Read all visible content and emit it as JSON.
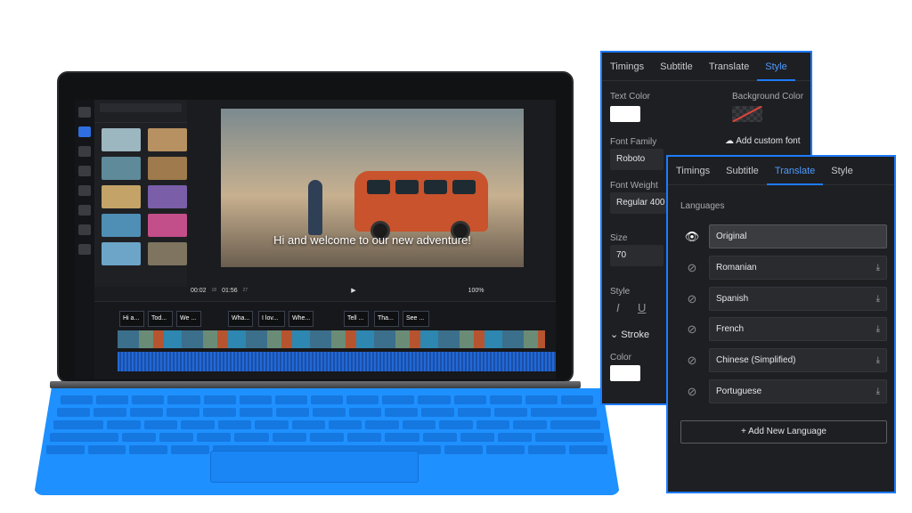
{
  "editor": {
    "current_time": "00:02",
    "current_time_frames": "18",
    "total_time": "01:56",
    "total_time_frames": "27",
    "zoom": "100%",
    "subtitle_text": "Hi and welcome to our new adventure!",
    "captions": [
      "Hi a...",
      "Tod...",
      "We ...",
      "Wha...",
      "I lov...",
      "Whe...",
      "Tell ...",
      "Tha...",
      "See ..."
    ]
  },
  "style_panel": {
    "tabs": [
      "Timings",
      "Subtitle",
      "Translate",
      "Style"
    ],
    "text_color_label": "Text Color",
    "text_color": "#ffffff",
    "background_color_label": "Background Color",
    "font_family_label": "Font Family",
    "add_custom_font": "Add custom font",
    "font_family_value": "Roboto",
    "font_weight_label": "Font Weight",
    "font_weight_value": "Regular 400",
    "size_label": "Size",
    "size_value": "70",
    "style_label": "Style",
    "stroke_label": "Stroke",
    "color_label": "Color",
    "stroke_color": "#ffffff"
  },
  "translate_panel": {
    "tabs": [
      "Timings",
      "Subtitle",
      "Translate",
      "Style"
    ],
    "languages_label": "Languages",
    "languages": [
      "Original",
      "Romanian",
      "Spanish",
      "French",
      "Chinese (Simplified)",
      "Portuguese"
    ],
    "add_language": "+ Add New Language"
  },
  "colors": {
    "accent": "#1e7bff",
    "panel_bg": "#1e1f22",
    "keyboard": "#1e90ff"
  },
  "icons": [
    "eye-icon",
    "eye-off-icon",
    "download-icon",
    "cloud-upload-icon",
    "italic-icon",
    "underline-icon",
    "chevron-down-icon",
    "play-icon"
  ]
}
